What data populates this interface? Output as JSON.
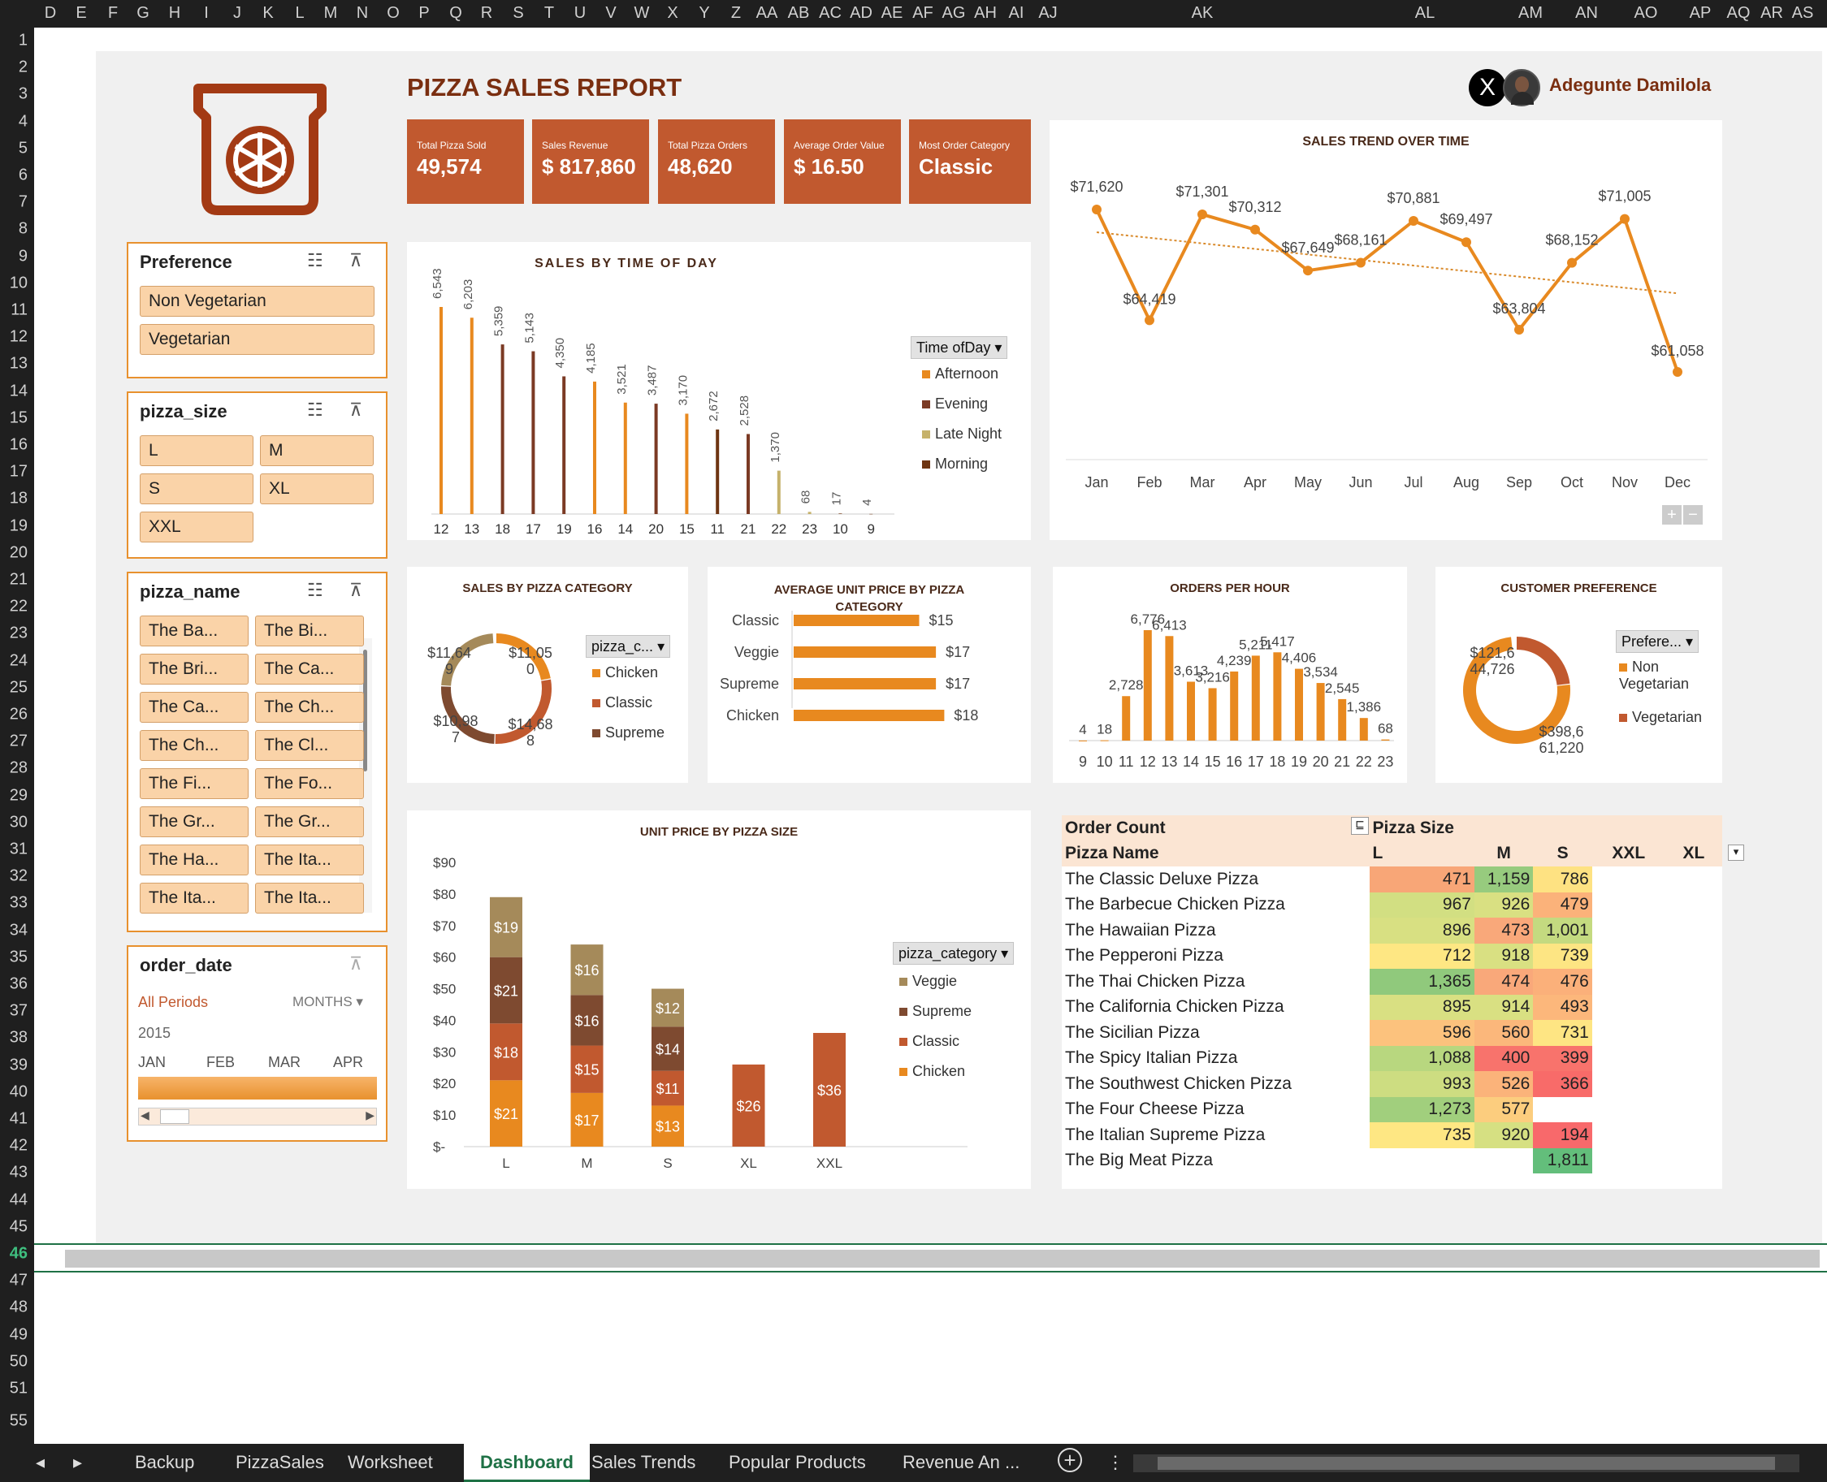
{
  "grid": {
    "columns": [
      "D",
      "E",
      "F",
      "G",
      "H",
      "I",
      "J",
      "K",
      "L",
      "M",
      "N",
      "O",
      "P",
      "Q",
      "R",
      "S",
      "T",
      "U",
      "V",
      "W",
      "X",
      "Y",
      "Z",
      "AA",
      "AB",
      "AC",
      "AD",
      "AE",
      "AF",
      "AG",
      "AH",
      "AI",
      "AJ",
      "AK",
      "AL",
      "AM",
      "AN",
      "AO",
      "AP",
      "AQ",
      "AR",
      "AS"
    ],
    "rows": [
      "1",
      "2",
      "3",
      "4",
      "5",
      "6",
      "7",
      "8",
      "9",
      "10",
      "11",
      "12",
      "13",
      "14",
      "15",
      "16",
      "17",
      "18",
      "19",
      "20",
      "21",
      "22",
      "23",
      "24",
      "25",
      "26",
      "27",
      "28",
      "29",
      "30",
      "31",
      "32",
      "33",
      "34",
      "35",
      "36",
      "37",
      "38",
      "39",
      "40",
      "41",
      "42",
      "43",
      "44",
      "45",
      "46",
      "47",
      "48",
      "49",
      "50",
      "51",
      "55"
    ]
  },
  "header": {
    "title": "PIZZA SALES REPORT",
    "author": "Adegunte Damilola",
    "x_icon": "X"
  },
  "kpis": [
    {
      "label": "Total Pizza Sold",
      "value": "49,574"
    },
    {
      "label": "Sales Revenue",
      "value": "$ 817,860"
    },
    {
      "label": "Total Pizza Orders",
      "value": "48,620"
    },
    {
      "label": "Average Order Value",
      "value": "$ 16.50"
    },
    {
      "label": "Most Order Category",
      "value": "Classic"
    }
  ],
  "slicers": {
    "preference": {
      "title": "Preference",
      "items": [
        "Non Vegetarian",
        "Vegetarian"
      ]
    },
    "pizza_size": {
      "title": "pizza_size",
      "items": [
        "L",
        "M",
        "S",
        "XL",
        "XXL"
      ]
    },
    "pizza_name": {
      "title": "pizza_name",
      "items": [
        "The Ba...",
        "The Bi...",
        "The Bri...",
        "The Ca...",
        "The Ca...",
        "The Ch...",
        "The Ch...",
        "The Cl...",
        "The Fi...",
        "The Fo...",
        "The Gr...",
        "The Gr...",
        "The Ha...",
        "The Ita...",
        "The Ita...",
        "The Ita..."
      ]
    },
    "order_date": {
      "title": "order_date",
      "period": "All Periods",
      "unit": "MONTHS",
      "year": "2015",
      "months": [
        "JAN",
        "FEB",
        "MAR",
        "APR"
      ]
    }
  },
  "colors": {
    "accent": "#c1592f",
    "orange": "#e8912e",
    "afternoon": "#e8891f",
    "evening": "#7b3a24",
    "late_night": "#c6b26b",
    "morning": "#6e3512",
    "veggie": "#a58a5a",
    "supreme": "#7e4a30",
    "classic": "#c1592f",
    "chicken": "#e8891f"
  },
  "chart_data": [
    {
      "id": "time_of_day",
      "type": "bar",
      "title": "SALES BY TIME OF DAY",
      "legend_title": "Time ofDay",
      "legend": [
        "Afternoon",
        "Evening",
        "Late Night",
        "Morning"
      ],
      "categories": [
        "12",
        "13",
        "18",
        "17",
        "19",
        "16",
        "14",
        "20",
        "15",
        "11",
        "21",
        "22",
        "23",
        "10",
        "9"
      ],
      "values": [
        6543,
        6203,
        5359,
        5143,
        4350,
        4185,
        3521,
        3487,
        3170,
        2672,
        2528,
        1370,
        68,
        17,
        4
      ],
      "labels": [
        "6,543",
        "6,203",
        "5,359",
        "5,143",
        "4,350",
        "4,185",
        "3,521",
        "3,487",
        "3,170",
        "2,672",
        "2,528",
        "1,370",
        "68",
        "17",
        "4"
      ],
      "series_of": [
        "Afternoon",
        "Afternoon",
        "Evening",
        "Evening",
        "Evening",
        "Afternoon",
        "Afternoon",
        "Evening",
        "Afternoon",
        "Morning",
        "Evening",
        "Late Night",
        "Late Night",
        "Morning",
        "Morning"
      ]
    },
    {
      "id": "trend",
      "type": "line",
      "title": "SALES TREND OVER TIME",
      "categories": [
        "Jan",
        "Feb",
        "Mar",
        "Apr",
        "May",
        "Jun",
        "Jul",
        "Aug",
        "Sep",
        "Oct",
        "Nov",
        "Dec"
      ],
      "values": [
        71620,
        64419,
        71301,
        70312,
        67649,
        68161,
        70881,
        69497,
        63804,
        68152,
        71005,
        61058
      ],
      "labels": [
        "$71,620",
        "$64,419",
        "$71,301",
        "$70,312",
        "$67,649",
        "$68,161",
        "$70,881",
        "$69,497",
        "$63,804",
        "$68,152",
        "$71,005",
        "$61,058"
      ],
      "trendline": true
    },
    {
      "id": "category",
      "type": "pie",
      "title": "SALES BY PIZZA CATEGORY",
      "legend_title": "pizza_c...",
      "legend": [
        "Chicken",
        "Classic",
        "Supreme"
      ],
      "labels_top": [
        "$11,64",
        "$11,05",
        "$14,68",
        "$10,98"
      ],
      "labels_bottom": [
        "9",
        "0",
        "8",
        "7"
      ]
    },
    {
      "id": "avg_price",
      "type": "bar",
      "title": "AVERAGE UNIT PRICE BY PIZZA CATEGORY",
      "categories": [
        "Classic",
        "Veggie",
        "Supreme",
        "Chicken"
      ],
      "values": [
        15,
        17,
        17,
        18
      ],
      "labels": [
        "$15",
        "$17",
        "$17",
        "$18"
      ]
    },
    {
      "id": "per_hour",
      "type": "bar",
      "title": "ORDERS PER HOUR",
      "categories": [
        "9",
        "10",
        "11",
        "12",
        "13",
        "14",
        "15",
        "16",
        "17",
        "18",
        "19",
        "20",
        "21",
        "22",
        "23"
      ],
      "values": [
        4,
        18,
        2728,
        6776,
        6413,
        3613,
        3216,
        4239,
        5211,
        5417,
        4406,
        3534,
        2545,
        1386,
        68
      ],
      "labels": [
        "4",
        "18",
        "2,728",
        "6,776",
        "6,413",
        "3,613",
        "3,216",
        "4,239",
        "5,211",
        "5,417",
        "4,406",
        "3,534",
        "2,545",
        "1,386",
        "68"
      ]
    },
    {
      "id": "preference",
      "type": "pie",
      "title": "CUSTOMER PREFERENCE",
      "legend_title": "Prefere...",
      "legend": [
        "Non Vegetarian",
        "Vegetarian"
      ],
      "labels_top": [
        "$121,6",
        "$398,6"
      ],
      "labels_bottom": [
        "44,726",
        "61,220"
      ]
    },
    {
      "id": "unit_size",
      "type": "bar",
      "title": "UNIT PRICE BY PIZZA SIZE",
      "legend_title": "pizza_category",
      "legend": [
        "Veggie",
        "Supreme",
        "Classic",
        "Chicken"
      ],
      "categories": [
        "L",
        "M",
        "S",
        "XL",
        "XXL"
      ],
      "y_ticks": [
        "$90",
        "$80",
        "$70",
        "$60",
        "$50",
        "$40",
        "$30",
        "$20",
        "$10",
        "$-"
      ],
      "ylim": [
        0,
        90
      ],
      "series": [
        {
          "name": "Chicken",
          "values": [
            21,
            17,
            13,
            0,
            0
          ],
          "labels": [
            "$21",
            "$17",
            "$13",
            "",
            ""
          ]
        },
        {
          "name": "Classic",
          "values": [
            18,
            15,
            11,
            26,
            36
          ],
          "labels": [
            "$18",
            "$15",
            "$11",
            "$26",
            "$36"
          ]
        },
        {
          "name": "Supreme",
          "values": [
            21,
            16,
            14,
            0,
            0
          ],
          "labels": [
            "$21",
            "$16",
            "$14",
            "",
            ""
          ]
        },
        {
          "name": "Veggie",
          "values": [
            19,
            16,
            12,
            0,
            0
          ],
          "labels": [
            "$19",
            "$16",
            "$12",
            "",
            ""
          ]
        }
      ]
    },
    {
      "id": "order_count",
      "type": "table",
      "header_left": "Order Count",
      "header_right": "Pizza Size",
      "columns": [
        "Pizza Name",
        "L",
        "M",
        "S",
        "XXL",
        "XL"
      ],
      "rows": [
        [
          "The Classic Deluxe Pizza",
          "471",
          "1,159",
          "786"
        ],
        [
          "The Barbecue Chicken Pizza",
          "967",
          "926",
          "479"
        ],
        [
          "The Hawaiian Pizza",
          "896",
          "473",
          "1,001"
        ],
        [
          "The Pepperoni Pizza",
          "712",
          "918",
          "739"
        ],
        [
          "The Thai Chicken Pizza",
          "1,365",
          "474",
          "476"
        ],
        [
          "The California Chicken Pizza",
          "895",
          "914",
          "493"
        ],
        [
          "The Sicilian Pizza",
          "596",
          "560",
          "731"
        ],
        [
          "The Spicy Italian Pizza",
          "1,088",
          "400",
          "399"
        ],
        [
          "The Southwest Chicken Pizza",
          "993",
          "526",
          "366"
        ],
        [
          "The Four Cheese Pizza",
          "1,273",
          "577",
          ""
        ],
        [
          "The Italian Supreme Pizza",
          "735",
          "920",
          "194"
        ],
        [
          "The Big Meat Pizza",
          "",
          "",
          "1,811"
        ]
      ],
      "cell_colors": [
        [
          "#f8a677",
          "#97cb7e",
          "#fee282"
        ],
        [
          "#d2df82",
          "#d9e082",
          "#fbb27a"
        ],
        [
          "#d8e082",
          "#f9a87a",
          "#c4da80"
        ],
        [
          "#fee783",
          "#d9e082",
          "#fde583"
        ],
        [
          "#90c97c",
          "#f9a87a",
          "#fbb07a"
        ],
        [
          "#d9e082",
          "#d9e082",
          "#fcb77b"
        ],
        [
          "#fcc27d",
          "#fbb77b",
          "#fee583"
        ],
        [
          "#b8d77f",
          "#f8736c",
          "#f8736c"
        ],
        [
          "#cddd81",
          "#fbb37a",
          "#f86b69"
        ],
        [
          "#a1cf7d",
          "#fccd7e",
          ""
        ],
        [
          "#fee783",
          "#d6e082",
          "#f8696b"
        ],
        [
          "",
          "",
          "#63be7b"
        ]
      ]
    }
  ],
  "tabs": [
    "Backup",
    "PizzaSales",
    "Worksheet",
    "Dashboard",
    "Sales Trends",
    "Popular Products",
    "Revenue An ..."
  ],
  "active_tab": "Dashboard"
}
